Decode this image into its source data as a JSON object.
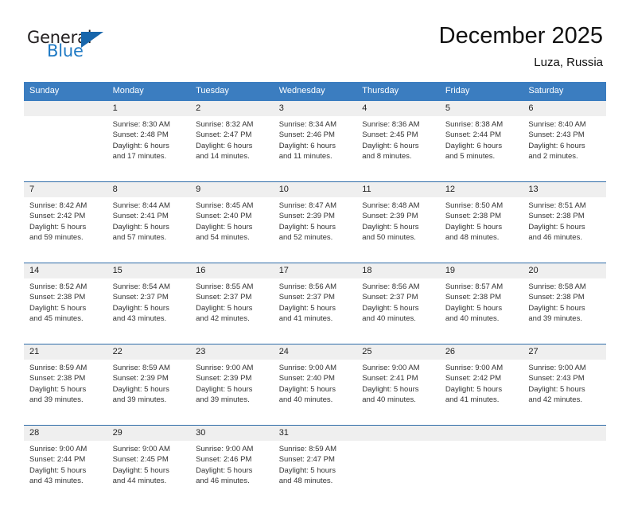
{
  "brand": {
    "word1": "General",
    "word2": "Blue",
    "flag_color": "#1866ab"
  },
  "header": {
    "title": "December 2025",
    "location": "Luza, Russia"
  },
  "theme": {
    "header_blue": "#3b7dc0",
    "separator_blue": "#2f6ca8",
    "daynum_band": "#efefef"
  },
  "weekdays": [
    "Sunday",
    "Monday",
    "Tuesday",
    "Wednesday",
    "Thursday",
    "Friday",
    "Saturday"
  ],
  "weeks": [
    [
      {
        "day": "",
        "sunrise": "",
        "sunset": "",
        "daylight1": "",
        "daylight2": ""
      },
      {
        "day": "1",
        "sunrise": "Sunrise: 8:30 AM",
        "sunset": "Sunset: 2:48 PM",
        "daylight1": "Daylight: 6 hours",
        "daylight2": "and 17 minutes."
      },
      {
        "day": "2",
        "sunrise": "Sunrise: 8:32 AM",
        "sunset": "Sunset: 2:47 PM",
        "daylight1": "Daylight: 6 hours",
        "daylight2": "and 14 minutes."
      },
      {
        "day": "3",
        "sunrise": "Sunrise: 8:34 AM",
        "sunset": "Sunset: 2:46 PM",
        "daylight1": "Daylight: 6 hours",
        "daylight2": "and 11 minutes."
      },
      {
        "day": "4",
        "sunrise": "Sunrise: 8:36 AM",
        "sunset": "Sunset: 2:45 PM",
        "daylight1": "Daylight: 6 hours",
        "daylight2": "and 8 minutes."
      },
      {
        "day": "5",
        "sunrise": "Sunrise: 8:38 AM",
        "sunset": "Sunset: 2:44 PM",
        "daylight1": "Daylight: 6 hours",
        "daylight2": "and 5 minutes."
      },
      {
        "day": "6",
        "sunrise": "Sunrise: 8:40 AM",
        "sunset": "Sunset: 2:43 PM",
        "daylight1": "Daylight: 6 hours",
        "daylight2": "and 2 minutes."
      }
    ],
    [
      {
        "day": "7",
        "sunrise": "Sunrise: 8:42 AM",
        "sunset": "Sunset: 2:42 PM",
        "daylight1": "Daylight: 5 hours",
        "daylight2": "and 59 minutes."
      },
      {
        "day": "8",
        "sunrise": "Sunrise: 8:44 AM",
        "sunset": "Sunset: 2:41 PM",
        "daylight1": "Daylight: 5 hours",
        "daylight2": "and 57 minutes."
      },
      {
        "day": "9",
        "sunrise": "Sunrise: 8:45 AM",
        "sunset": "Sunset: 2:40 PM",
        "daylight1": "Daylight: 5 hours",
        "daylight2": "and 54 minutes."
      },
      {
        "day": "10",
        "sunrise": "Sunrise: 8:47 AM",
        "sunset": "Sunset: 2:39 PM",
        "daylight1": "Daylight: 5 hours",
        "daylight2": "and 52 minutes."
      },
      {
        "day": "11",
        "sunrise": "Sunrise: 8:48 AM",
        "sunset": "Sunset: 2:39 PM",
        "daylight1": "Daylight: 5 hours",
        "daylight2": "and 50 minutes."
      },
      {
        "day": "12",
        "sunrise": "Sunrise: 8:50 AM",
        "sunset": "Sunset: 2:38 PM",
        "daylight1": "Daylight: 5 hours",
        "daylight2": "and 48 minutes."
      },
      {
        "day": "13",
        "sunrise": "Sunrise: 8:51 AM",
        "sunset": "Sunset: 2:38 PM",
        "daylight1": "Daylight: 5 hours",
        "daylight2": "and 46 minutes."
      }
    ],
    [
      {
        "day": "14",
        "sunrise": "Sunrise: 8:52 AM",
        "sunset": "Sunset: 2:38 PM",
        "daylight1": "Daylight: 5 hours",
        "daylight2": "and 45 minutes."
      },
      {
        "day": "15",
        "sunrise": "Sunrise: 8:54 AM",
        "sunset": "Sunset: 2:37 PM",
        "daylight1": "Daylight: 5 hours",
        "daylight2": "and 43 minutes."
      },
      {
        "day": "16",
        "sunrise": "Sunrise: 8:55 AM",
        "sunset": "Sunset: 2:37 PM",
        "daylight1": "Daylight: 5 hours",
        "daylight2": "and 42 minutes."
      },
      {
        "day": "17",
        "sunrise": "Sunrise: 8:56 AM",
        "sunset": "Sunset: 2:37 PM",
        "daylight1": "Daylight: 5 hours",
        "daylight2": "and 41 minutes."
      },
      {
        "day": "18",
        "sunrise": "Sunrise: 8:56 AM",
        "sunset": "Sunset: 2:37 PM",
        "daylight1": "Daylight: 5 hours",
        "daylight2": "and 40 minutes."
      },
      {
        "day": "19",
        "sunrise": "Sunrise: 8:57 AM",
        "sunset": "Sunset: 2:38 PM",
        "daylight1": "Daylight: 5 hours",
        "daylight2": "and 40 minutes."
      },
      {
        "day": "20",
        "sunrise": "Sunrise: 8:58 AM",
        "sunset": "Sunset: 2:38 PM",
        "daylight1": "Daylight: 5 hours",
        "daylight2": "and 39 minutes."
      }
    ],
    [
      {
        "day": "21",
        "sunrise": "Sunrise: 8:59 AM",
        "sunset": "Sunset: 2:38 PM",
        "daylight1": "Daylight: 5 hours",
        "daylight2": "and 39 minutes."
      },
      {
        "day": "22",
        "sunrise": "Sunrise: 8:59 AM",
        "sunset": "Sunset: 2:39 PM",
        "daylight1": "Daylight: 5 hours",
        "daylight2": "and 39 minutes."
      },
      {
        "day": "23",
        "sunrise": "Sunrise: 9:00 AM",
        "sunset": "Sunset: 2:39 PM",
        "daylight1": "Daylight: 5 hours",
        "daylight2": "and 39 minutes."
      },
      {
        "day": "24",
        "sunrise": "Sunrise: 9:00 AM",
        "sunset": "Sunset: 2:40 PM",
        "daylight1": "Daylight: 5 hours",
        "daylight2": "and 40 minutes."
      },
      {
        "day": "25",
        "sunrise": "Sunrise: 9:00 AM",
        "sunset": "Sunset: 2:41 PM",
        "daylight1": "Daylight: 5 hours",
        "daylight2": "and 40 minutes."
      },
      {
        "day": "26",
        "sunrise": "Sunrise: 9:00 AM",
        "sunset": "Sunset: 2:42 PM",
        "daylight1": "Daylight: 5 hours",
        "daylight2": "and 41 minutes."
      },
      {
        "day": "27",
        "sunrise": "Sunrise: 9:00 AM",
        "sunset": "Sunset: 2:43 PM",
        "daylight1": "Daylight: 5 hours",
        "daylight2": "and 42 minutes."
      }
    ],
    [
      {
        "day": "28",
        "sunrise": "Sunrise: 9:00 AM",
        "sunset": "Sunset: 2:44 PM",
        "daylight1": "Daylight: 5 hours",
        "daylight2": "and 43 minutes."
      },
      {
        "day": "29",
        "sunrise": "Sunrise: 9:00 AM",
        "sunset": "Sunset: 2:45 PM",
        "daylight1": "Daylight: 5 hours",
        "daylight2": "and 44 minutes."
      },
      {
        "day": "30",
        "sunrise": "Sunrise: 9:00 AM",
        "sunset": "Sunset: 2:46 PM",
        "daylight1": "Daylight: 5 hours",
        "daylight2": "and 46 minutes."
      },
      {
        "day": "31",
        "sunrise": "Sunrise: 8:59 AM",
        "sunset": "Sunset: 2:47 PM",
        "daylight1": "Daylight: 5 hours",
        "daylight2": "and 48 minutes."
      },
      {
        "day": "",
        "sunrise": "",
        "sunset": "",
        "daylight1": "",
        "daylight2": ""
      },
      {
        "day": "",
        "sunrise": "",
        "sunset": "",
        "daylight1": "",
        "daylight2": ""
      },
      {
        "day": "",
        "sunrise": "",
        "sunset": "",
        "daylight1": "",
        "daylight2": ""
      }
    ]
  ]
}
